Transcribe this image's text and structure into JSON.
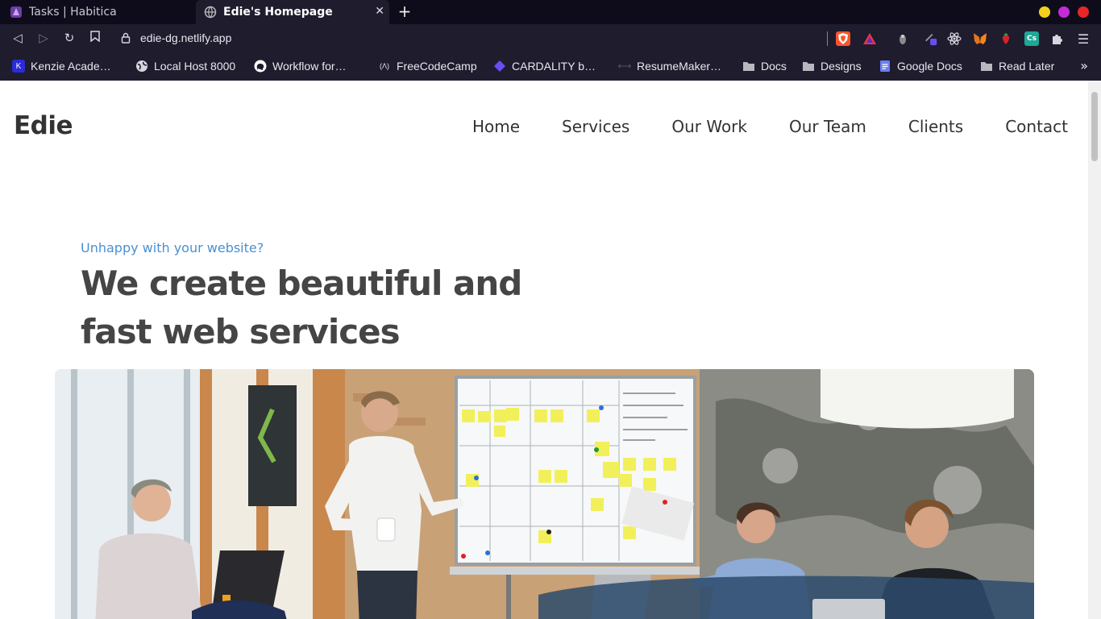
{
  "browser": {
    "tabs": [
      {
        "title": "Tasks | Habitica",
        "active": false
      },
      {
        "title": "Edie's Homepage",
        "active": true
      }
    ],
    "url": "edie-dg.netlify.app",
    "bookmarks": [
      {
        "label": "Kenzie Acade…",
        "icon": "kenzie-icon"
      },
      {
        "label": "Local Host 8000",
        "icon": "globe-icon"
      },
      {
        "label": "Workflow for…",
        "icon": "github-icon"
      },
      {
        "label": "FreeCodeCamp",
        "icon": "freecodecamp-icon"
      },
      {
        "label": "CARDALITY b…",
        "icon": "cardality-icon"
      },
      {
        "label": "ResumeMaker…",
        "icon": "link-icon"
      },
      {
        "label": "Docs",
        "icon": "folder-icon"
      },
      {
        "label": "Designs",
        "icon": "folder-icon"
      },
      {
        "label": "Google Docs",
        "icon": "google-docs-icon"
      },
      {
        "label": "Read Later",
        "icon": "folder-icon"
      }
    ],
    "colors": {
      "chrome_dark": "#0e0c1b",
      "chrome": "#1f1c2e"
    }
  },
  "site": {
    "logo": "Edie",
    "nav": [
      "Home",
      "Services",
      "Our Work",
      "Our Team",
      "Clients",
      "Contact"
    ],
    "kicker": "Unhappy with your website?",
    "headline": "We create beautiful and fast web services",
    "colors": {
      "accent": "#4a8fd4",
      "text": "#454545"
    }
  }
}
